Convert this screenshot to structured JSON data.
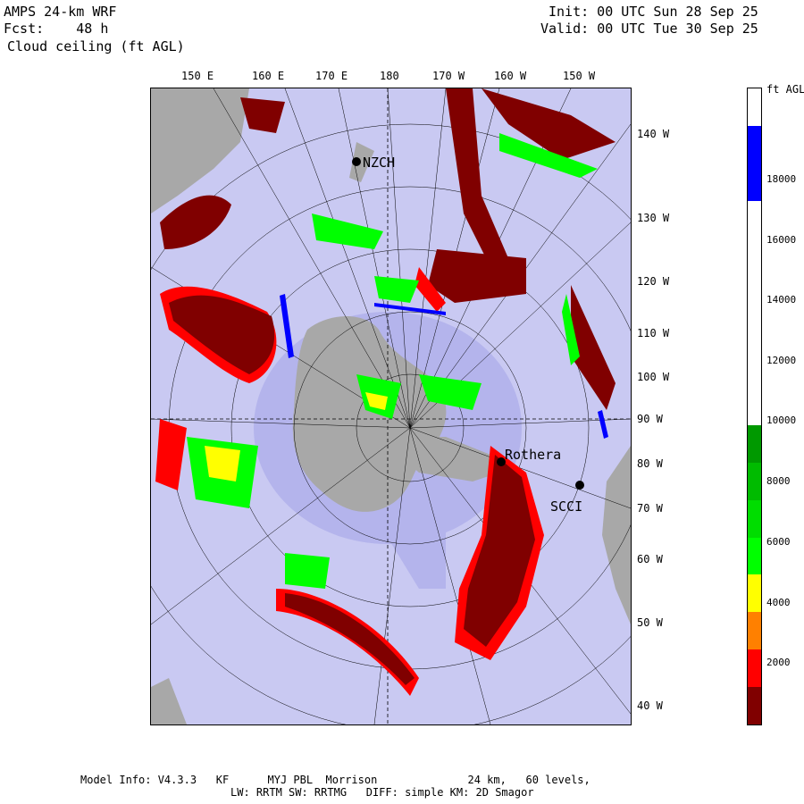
{
  "header": {
    "left_line1": "AMPS 24-km WRF",
    "left_line2": "Fcst:    48 h",
    "left_line3": "Cloud ceiling (ft AGL)",
    "right_line1": "Init: 00 UTC Sun 28 Sep 25",
    "right_line2": "Valid: 00 UTC Tue 30 Sep 25"
  },
  "map": {
    "lon_labels_top": [
      "150 E",
      "160 E",
      "170 E",
      "180",
      "170 W",
      "160 W",
      "150 W"
    ],
    "lat_labels_right": [
      "140 W",
      "130 W",
      "120 W",
      "110 W",
      "100 W",
      "90 W",
      "80 W",
      "70 W",
      "60 W",
      "50 W",
      "40 W"
    ],
    "stations": [
      {
        "name": "NZCH"
      },
      {
        "name": "SCCI"
      },
      {
        "name": "Rothera"
      }
    ],
    "colors": {
      "ocean": "#c9c9f2",
      "land": "#a8a8a8",
      "ice_shelf": "#b4b4ec"
    }
  },
  "colorbar": {
    "unit_label": "ft AGL",
    "tick_labels": [
      "18000",
      "16000",
      "14000",
      "12000",
      "10000",
      "8000",
      "6000",
      "4000",
      "2000"
    ],
    "segments": [
      {
        "color": "#ffffff"
      },
      {
        "color": "#0000ff"
      },
      {
        "color": "#0000ff"
      },
      {
        "color": "#ffffff"
      },
      {
        "color": "#ffffff"
      },
      {
        "color": "#ffffff"
      },
      {
        "color": "#ffffff"
      },
      {
        "color": "#ffffff"
      },
      {
        "color": "#ffffff"
      },
      {
        "color": "#009900"
      },
      {
        "color": "#00bb00"
      },
      {
        "color": "#00dd00"
      },
      {
        "color": "#00ff00"
      },
      {
        "color": "#ffff00"
      },
      {
        "color": "#ff8000"
      },
      {
        "color": "#ff0000"
      },
      {
        "color": "#800000"
      }
    ]
  },
  "footer": {
    "line1": "Model Info: V4.3.3   KF      MYJ PBL  Morrison              24 km,   60 levels,",
    "line2": "LW: RRTM SW: RRTMG   DIFF: simple KM: 2D Smagor"
  }
}
